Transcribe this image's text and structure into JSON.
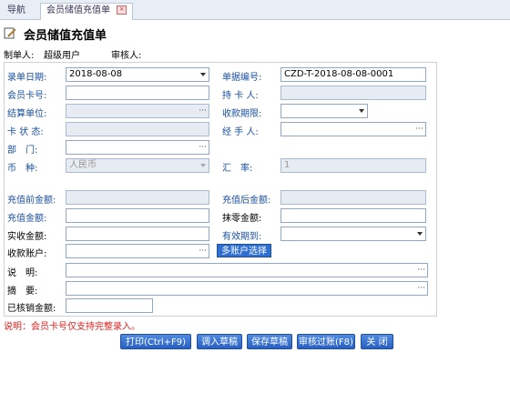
{
  "tabs": [
    {
      "label": "导航",
      "active": false
    },
    {
      "label": "会员储值充值单",
      "active": true
    }
  ],
  "title": "会员储值充值单",
  "meta": {
    "maker_label": "制单人:",
    "maker_value": "超级用户",
    "auditor_label": "审核人:",
    "auditor_value": ""
  },
  "form": {
    "entry_date": {
      "label": "录单日期:",
      "value": "2018-08-08"
    },
    "doc_no": {
      "label": "单据编号:",
      "value": "CZD-T-2018-08-08-0001"
    },
    "member_card": {
      "label": "会员卡号:",
      "value": ""
    },
    "card_holder": {
      "label": "持 卡 人:",
      "value": ""
    },
    "settle_unit": {
      "label": "结算单位:",
      "value": ""
    },
    "pay_period": {
      "label": "收款期限:",
      "value": ""
    },
    "card_status": {
      "label": "卡 状 态:",
      "value": ""
    },
    "handler": {
      "label": "经 手 人:",
      "value": ""
    },
    "department": {
      "label": "部　门:",
      "value": ""
    },
    "currency": {
      "label": "币　种:",
      "value": "人民币"
    },
    "exchange_rate": {
      "label": "汇　率:",
      "value": "1"
    },
    "balance_before": {
      "label": "充值前金额:",
      "value": ""
    },
    "balance_after": {
      "label": "充值后金额:",
      "value": ""
    },
    "recharge_amount": {
      "label": "充值金额:",
      "value": ""
    },
    "rounding": {
      "label": "抹零金额:",
      "value": ""
    },
    "received_amount": {
      "label": "实收金额:",
      "value": ""
    },
    "valid_until": {
      "label": "有效期到:",
      "value": ""
    },
    "receipt_account": {
      "label": "收款账户:",
      "value": ""
    },
    "multi_account_button": "多账户选择",
    "description": {
      "label": "说　明:",
      "value": ""
    },
    "summary": {
      "label": "摘　要:",
      "value": ""
    },
    "written_off": {
      "label": "已核销金额:",
      "value": ""
    }
  },
  "note": "说明：会员卡号仅支持完整录入。",
  "buttons": {
    "print": "打印(Ctrl+F9)",
    "load_draft": "调入草稿",
    "save_draft": "保存草稿",
    "audit_pass": "审核过账(F8)",
    "close": "关 闭"
  },
  "colors": {
    "label_blue": "#1a4fa0",
    "button_blue": "#2f6fd0",
    "note_red": "#e02020"
  }
}
